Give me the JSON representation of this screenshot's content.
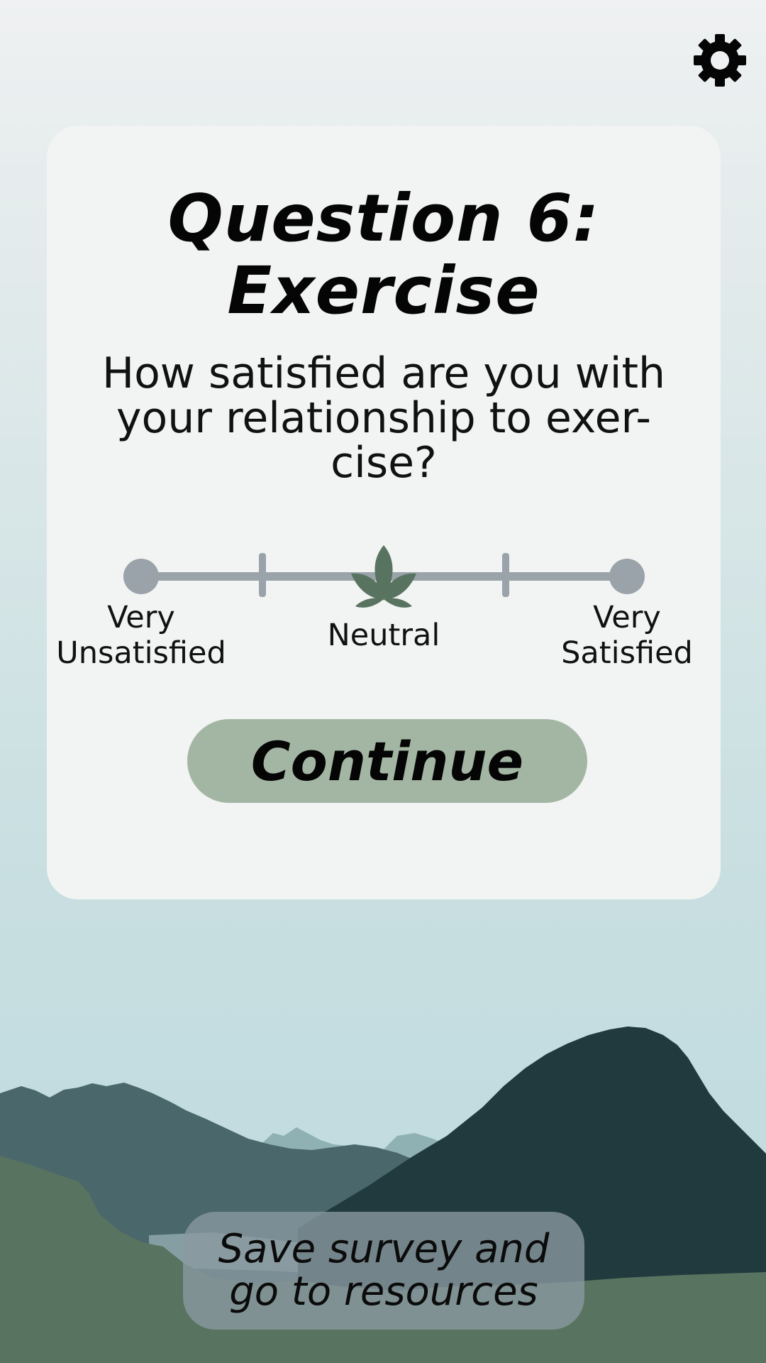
{
  "settings": {
    "icon": "gear-icon"
  },
  "card": {
    "title_line1": "Question 6:",
    "title_line2": "Exercise",
    "question": "How satisfied are you with your relationship to exer-cise?",
    "question_lines": [
      "How satisfied are you with",
      "your relationship to exer-",
      "cise?"
    ]
  },
  "scale": {
    "steps": 5,
    "selected_step": 3,
    "selected_marker_icon": "leaf-icon",
    "label_left_line1": "Very",
    "label_left_line2": "Unsatisfied",
    "label_center": "Neutral",
    "label_right_line1": "Very",
    "label_right_line2": "Satisfied"
  },
  "actions": {
    "continue_label": "Continue",
    "save_line1": "Save survey and",
    "save_line2": "go to resources"
  },
  "colors": {
    "track": "#9aa3aa",
    "marker": "#587360",
    "continue_bg": "#a3b6a3",
    "card_bg": "#f2f3f3"
  }
}
